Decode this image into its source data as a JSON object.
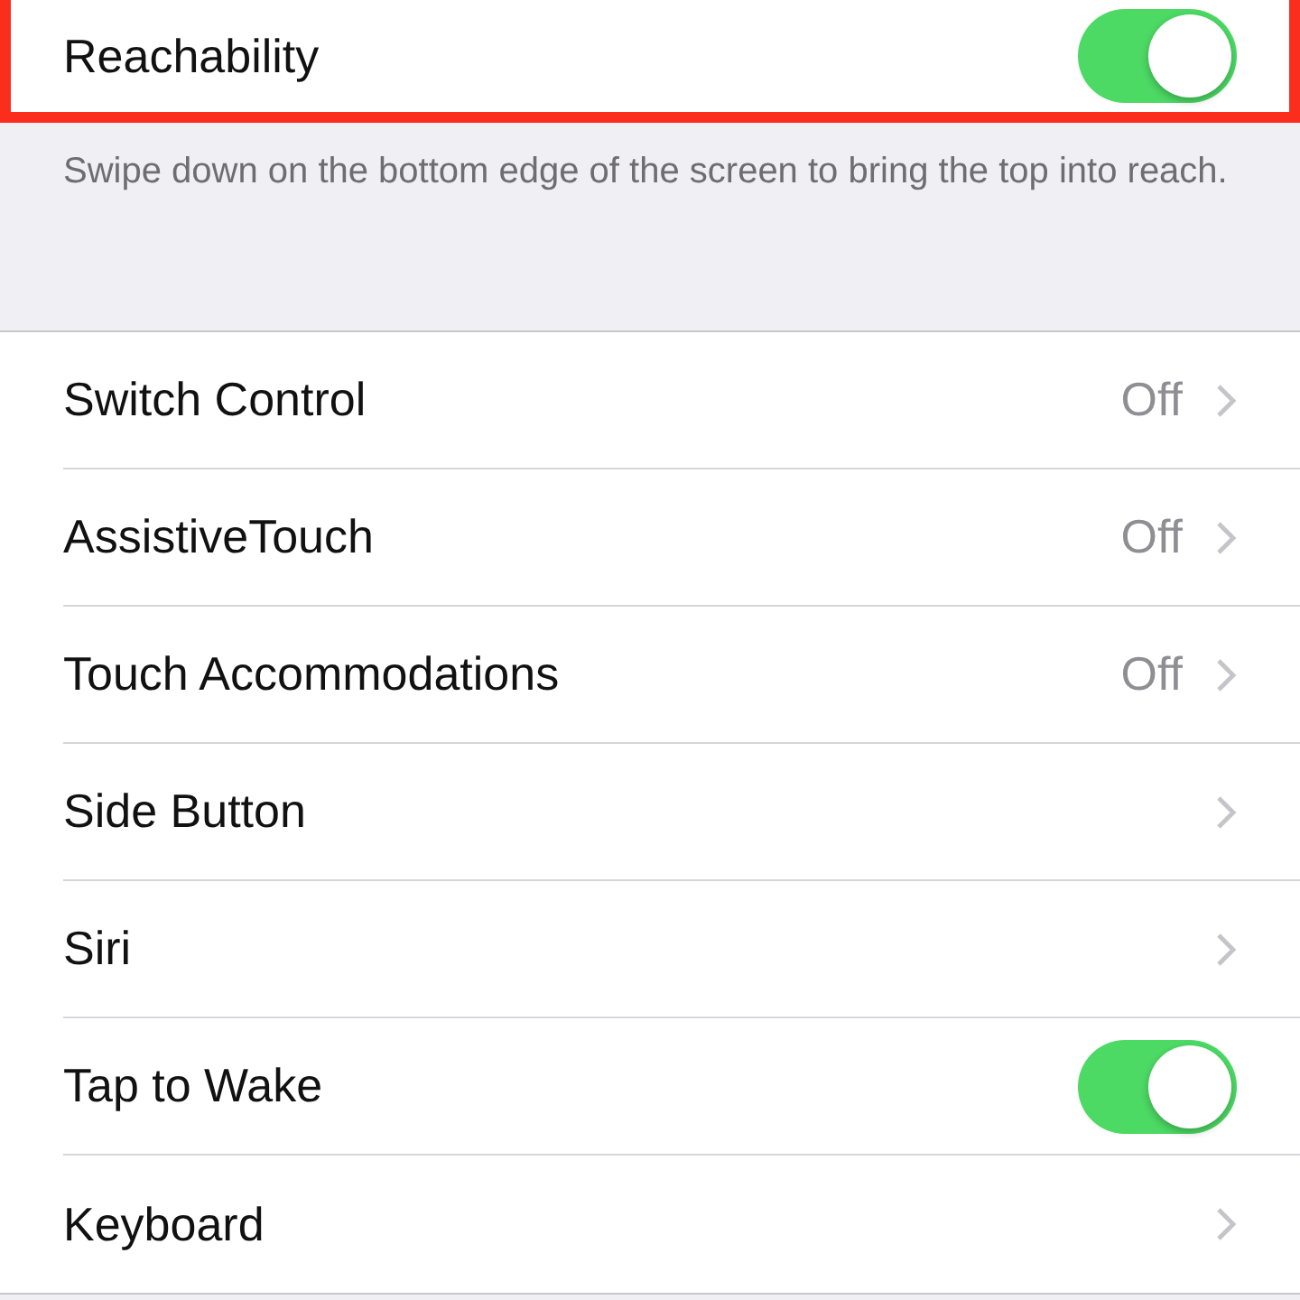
{
  "top_group": {
    "rows": [
      {
        "label": "Reachability",
        "kind": "toggle",
        "on": true,
        "highlighted": true
      }
    ]
  },
  "footer": "Swipe down on the bottom edge of the screen to bring the top into reach.",
  "group": {
    "rows": [
      {
        "label": "Switch Control",
        "kind": "link",
        "value": "Off"
      },
      {
        "label": "AssistiveTouch",
        "kind": "link",
        "value": "Off"
      },
      {
        "label": "Touch Accommodations",
        "kind": "link",
        "value": "Off"
      },
      {
        "label": "Side Button",
        "kind": "link"
      },
      {
        "label": "Siri",
        "kind": "link"
      },
      {
        "label": "Tap to Wake",
        "kind": "toggle",
        "on": true
      },
      {
        "label": "Keyboard",
        "kind": "link"
      }
    ]
  }
}
